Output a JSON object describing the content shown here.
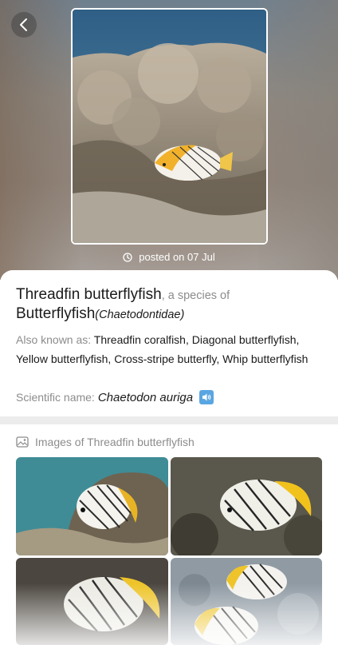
{
  "header": {
    "posted_text": "posted on 07 Jul"
  },
  "species": {
    "common_name": "Threadfin butterflyfish",
    "species_of": ", a species of",
    "family_name": "Butterflyfish",
    "family_scientific": "(Chaetodontidae)",
    "aka_label": "Also known as: ",
    "aka_value": "Threadfin coralfish, Diagonal butterflyfish, Yellow butterflyfish, Cross-stripe butterfly, Whip butterflyfish",
    "scientific_label": "Scientific name:",
    "scientific_value": "Chaetodon auriga"
  },
  "images_section": {
    "title": "Images of Threadfin butterflyfish"
  },
  "icons": {
    "back": "chevron-left-icon",
    "clock": "clock-icon",
    "speaker": "speaker-icon",
    "gallery": "image-gallery-icon"
  },
  "colors": {
    "accent": "#5aa6e2",
    "muted_text": "#8c8c8c",
    "primary_text": "#1a1a1a"
  }
}
